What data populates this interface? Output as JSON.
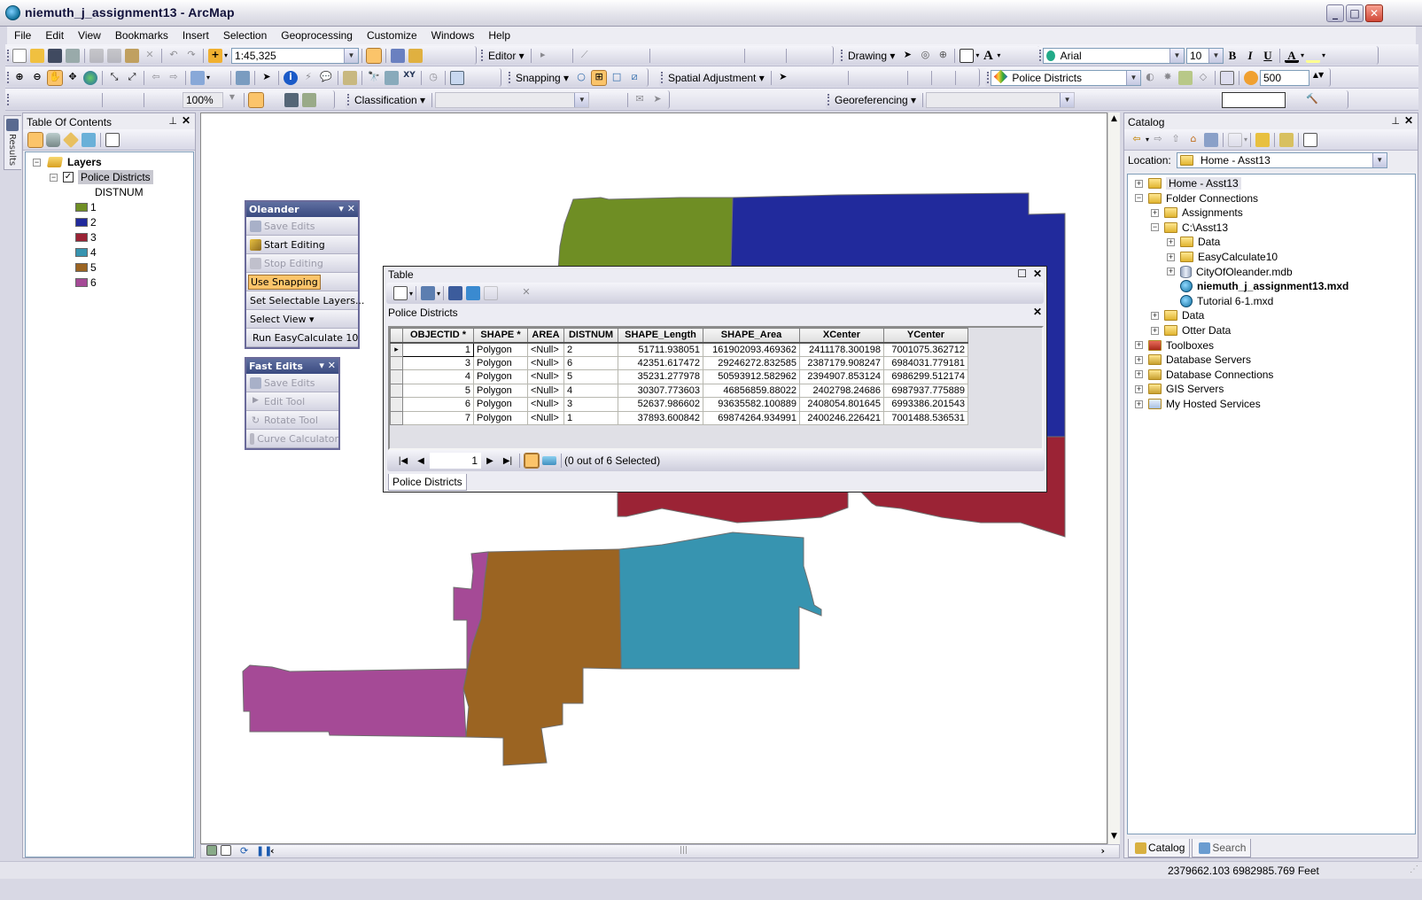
{
  "window": {
    "title": "niemuth_j_assignment13 - ArcMap",
    "min_label": "_",
    "max_label": "□",
    "close_label": "✕"
  },
  "menu": [
    "File",
    "Edit",
    "View",
    "Bookmarks",
    "Insert",
    "Selection",
    "Geoprocessing",
    "Customize",
    "Windows",
    "Help"
  ],
  "toolbars": {
    "scale_value": "1:45,325",
    "editor_label": "Editor ▾",
    "drawing_label": "Drawing ▾",
    "font_name": "Arial",
    "font_size": "10",
    "bold": "B",
    "italic": "I",
    "underline": "U",
    "snapping_label": "Snapping ▾",
    "spatial_adjustment_label": "Spatial Adjustment ▾",
    "layer_combo": "Police Districts",
    "effects_value": "500",
    "zoom_percent": "100%",
    "classification_label": "Classification ▾",
    "georeferencing_label": "Georeferencing ▾"
  },
  "results_tab": {
    "label": "Results"
  },
  "toc": {
    "title": "Table Of Contents",
    "pin": "📌",
    "close": "✕",
    "root": "Layers",
    "layer": {
      "name": "Police Districts",
      "checked": true,
      "field": "DISTNUM"
    },
    "legend": [
      {
        "label": "1",
        "color": "#6f8e24"
      },
      {
        "label": "2",
        "color": "#212a9c"
      },
      {
        "label": "3",
        "color": "#9b2335"
      },
      {
        "label": "4",
        "color": "#3794b0"
      },
      {
        "label": "5",
        "color": "#9b6422"
      },
      {
        "label": "6",
        "color": "#a54a96"
      }
    ]
  },
  "oleander_toolbar": {
    "title": "Oleander",
    "items": [
      {
        "label": "Save Edits",
        "enabled": false
      },
      {
        "label": "Start Editing",
        "enabled": true
      },
      {
        "label": "Stop Editing",
        "enabled": false
      },
      {
        "label": "Use Snapping",
        "enabled": true,
        "active": true
      },
      {
        "label": "Set Selectable Layers...",
        "enabled": true
      },
      {
        "label": "Select View ▾",
        "enabled": true
      },
      {
        "label": "Run EasyCalculate 10",
        "enabled": true
      }
    ]
  },
  "fast_edits_toolbar": {
    "title": "Fast Edits",
    "items": [
      {
        "label": "Save Edits",
        "enabled": false
      },
      {
        "label": "Edit Tool",
        "enabled": false
      },
      {
        "label": "Rotate Tool",
        "enabled": false
      },
      {
        "label": "Curve Calculator",
        "enabled": false
      }
    ]
  },
  "table_window": {
    "title": "Table",
    "layer_title": "Police Districts",
    "columns": [
      "OBJECTID *",
      "SHAPE *",
      "AREA",
      "DISTNUM",
      "SHAPE_Length",
      "SHAPE_Area",
      "XCenter",
      "YCenter"
    ],
    "rows": [
      [
        "1",
        "Polygon",
        "<Null>",
        "2",
        "51711.938051",
        "161902093.469362",
        "2411178.300198",
        "7001075.362712"
      ],
      [
        "3",
        "Polygon",
        "<Null>",
        "6",
        "42351.617472",
        "29246272.832585",
        "2387179.908247",
        "6984031.779181"
      ],
      [
        "4",
        "Polygon",
        "<Null>",
        "5",
        "35231.277978",
        "50593912.582962",
        "2394907.853124",
        "6986299.512174"
      ],
      [
        "5",
        "Polygon",
        "<Null>",
        "4",
        "30307.773603",
        "46856859.88022",
        "2402798.24686",
        "6987937.775889"
      ],
      [
        "6",
        "Polygon",
        "<Null>",
        "3",
        "52637.986602",
        "93635582.100889",
        "2408054.801645",
        "6993386.201543"
      ],
      [
        "7",
        "Polygon",
        "<Null>",
        "1",
        "37893.600842",
        "69874264.934991",
        "2400246.226421",
        "7001488.536531"
      ]
    ],
    "current_record": "1",
    "selection_status": "(0 out of 6 Selected)",
    "tab_label": "Police Districts"
  },
  "catalog": {
    "title": "Catalog",
    "location_label": "Location:",
    "location_value": "Home - Asst13",
    "tree": [
      {
        "label": "Home - Asst13",
        "level": 0,
        "toggle": "+",
        "icon": "home-folder",
        "highlight": true
      },
      {
        "label": "Folder Connections",
        "level": 0,
        "toggle": "−",
        "icon": "folder"
      },
      {
        "label": "Assignments",
        "level": 1,
        "toggle": "+",
        "icon": "folder"
      },
      {
        "label": "C:\\Asst13",
        "level": 1,
        "toggle": "−",
        "icon": "folder"
      },
      {
        "label": "Data",
        "level": 2,
        "toggle": "+",
        "icon": "folder"
      },
      {
        "label": "EasyCalculate10",
        "level": 2,
        "toggle": "+",
        "icon": "folder"
      },
      {
        "label": "CityOfOleander.mdb",
        "level": 2,
        "toggle": "+",
        "icon": "database"
      },
      {
        "label": "niemuth_j_assignment13.mxd",
        "level": 2,
        "toggle": "",
        "icon": "mxd",
        "bold": true
      },
      {
        "label": "Tutorial 6-1.mxd",
        "level": 2,
        "toggle": "",
        "icon": "mxd"
      },
      {
        "label": "Data",
        "level": 1,
        "toggle": "+",
        "icon": "folder"
      },
      {
        "label": "Otter Data",
        "level": 1,
        "toggle": "+",
        "icon": "folder"
      },
      {
        "label": "Toolboxes",
        "level": 0,
        "toggle": "+",
        "icon": "toolbox"
      },
      {
        "label": "Database Servers",
        "level": 0,
        "toggle": "+",
        "icon": "server-folder"
      },
      {
        "label": "Database Connections",
        "level": 0,
        "toggle": "+",
        "icon": "server-folder"
      },
      {
        "label": "GIS Servers",
        "level": 0,
        "toggle": "+",
        "icon": "server-folder"
      },
      {
        "label": "My Hosted Services",
        "level": 0,
        "toggle": "+",
        "icon": "cloud-folder"
      }
    ],
    "tabs": [
      "Catalog",
      "Search"
    ]
  },
  "status": {
    "coordinates": "2379662.103  6982985.769 Feet"
  }
}
